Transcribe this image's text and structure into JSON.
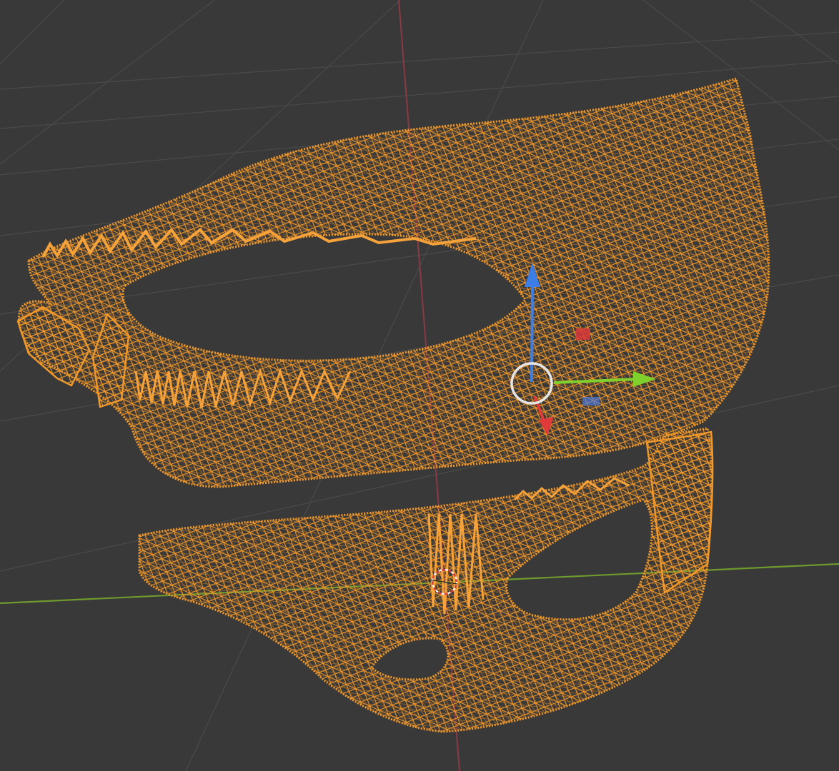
{
  "viewport": {
    "mode": "wireframe",
    "selection_state": "all-selected",
    "active_tool": "move-gizmo"
  },
  "colors": {
    "background": "#393939",
    "grid": "#4a4a4a",
    "axis_x": "#8a3a44",
    "axis_y": "#6f9a2e",
    "wire_selected": "#f0982a",
    "wire_dark": "#b8661c",
    "gizmo_z": "#3d7ee6",
    "gizmo_y": "#7fd02a",
    "gizmo_x": "#e03a3a",
    "gizmo_ring": "#e6e6e6",
    "cursor_3d": "#ffffff"
  },
  "objects": [
    {
      "name": "upper-jaw-mesh",
      "state": "selected"
    },
    {
      "name": "lower-jaw-mesh",
      "state": "selected"
    }
  ],
  "gizmo": {
    "axes": [
      "z",
      "y",
      "x"
    ],
    "plane_handles": [
      "xz-plane",
      "yz-plane"
    ]
  },
  "icons": {
    "cursor": "3d-cursor-icon",
    "origin": "object-origin-icon"
  }
}
